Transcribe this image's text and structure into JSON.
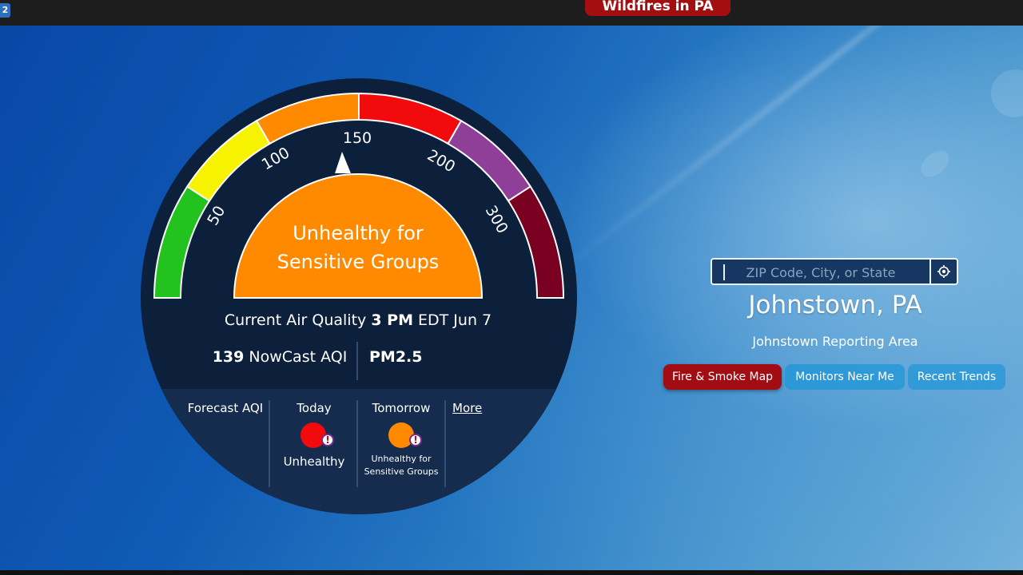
{
  "corner_badge": "2",
  "alert_banner": {
    "label": "Wildfires in PA"
  },
  "gauge": {
    "segments": [
      {
        "color": "#22c21f"
      },
      {
        "color": "#f7f200"
      },
      {
        "color": "#ff8a00"
      },
      {
        "color": "#f20b0d"
      },
      {
        "color": "#8f3f97"
      },
      {
        "color": "#7a0022"
      }
    ],
    "tick_labels": [
      "50",
      "100",
      "150",
      "200",
      "300"
    ],
    "category_line1": "Unhealthy for",
    "category_line2": "Sensitive Groups",
    "category_color": "#ff8a00",
    "pointer_value": 150
  },
  "current": {
    "prefix": "Current Air Quality",
    "time": "3 PM",
    "suffix": "EDT Jun 7"
  },
  "nowcast": {
    "value": "139",
    "label": "NowCast AQI"
  },
  "pollutant": "PM2.5",
  "forecast": {
    "title": "Forecast AQI",
    "today_label": "Today",
    "today_category": "Unhealthy",
    "today_color": "#f20b0d",
    "tomorrow_label": "Tomorrow",
    "tomorrow_category": "Unhealthy for Sensitive Groups",
    "tomorrow_color": "#ff8a00",
    "alert_mark": "!",
    "more_link": "More"
  },
  "search": {
    "placeholder": "ZIP Code, City, or State",
    "locate_icon": "location-target-icon"
  },
  "location": {
    "city": "Johnstown, PA",
    "area": "Johnstown Reporting Area"
  },
  "buttons": {
    "fire_smoke": "Fire & Smoke Map",
    "monitors": "Monitors Near Me",
    "trends": "Recent Trends"
  },
  "colors": {
    "hero_blue": "#0f5bb4",
    "gauge_panel": "#0c1f3b",
    "fire_button": "#a10d12",
    "secondary_button": "#1e96d7"
  }
}
